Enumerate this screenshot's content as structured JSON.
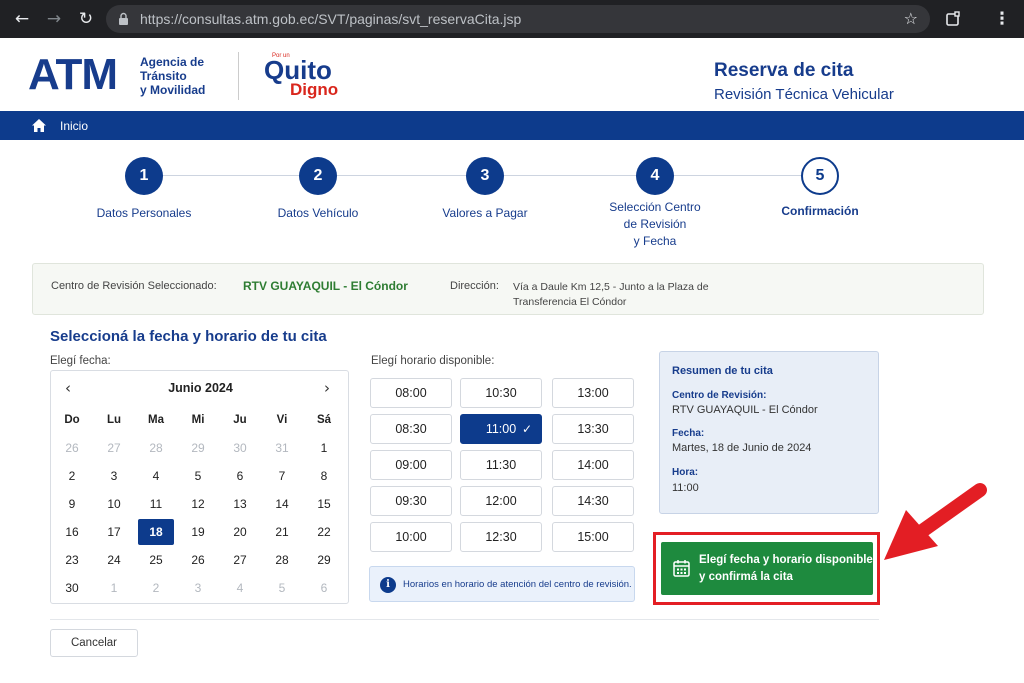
{
  "browser": {
    "url": "https://consultas.atm.gob.ec/SVT/paginas/svt_reservaCita.jsp"
  },
  "header": {
    "logo_text": "ATM",
    "logo_sub": [
      "Agencia de",
      "Tránsito",
      "y Movilidad"
    ],
    "quito_small": "Por un",
    "quito": "Quito",
    "digno": "Digno",
    "title": "Reserva de cita",
    "subtitle": "Revisión Técnica Vehicular"
  },
  "navbar": {
    "home_label": "Inicio"
  },
  "steps": [
    {
      "number": "1",
      "label": "Datos Personales",
      "state": "completed"
    },
    {
      "number": "2",
      "label": "Datos Vehículo",
      "state": "completed"
    },
    {
      "number": "3",
      "label": "Valores a Pagar",
      "state": "completed"
    },
    {
      "number": "4",
      "label_lines": [
        "Selección Centro",
        "de Revisión",
        "y Fecha"
      ],
      "state": "completed"
    },
    {
      "number": "5",
      "label": "Confirmación",
      "state": "current"
    }
  ],
  "center": {
    "label": "Centro de Revisión Seleccionado:",
    "value": "RTV GUAYAQUIL - El Cóndor",
    "dir_label": "Dirección:",
    "dir_value_lines": [
      "Vía a Daule Km 12,5 - Junto a la Plaza de",
      "Transferencia El Cóndor"
    ]
  },
  "main": {
    "section_title": "Seleccioná la fecha y horario de tu cita",
    "fecha_label": "Elegí fecha:",
    "horario_label": "Elegí horario disponible:"
  },
  "calendar": {
    "month_label": "Junio  2024",
    "weekdays": [
      "Do",
      "Lu",
      "Ma",
      "Mi",
      "Ju",
      "Vi",
      "Sá"
    ],
    "weeks": [
      [
        [
          "26",
          1
        ],
        [
          "27",
          1
        ],
        [
          "28",
          1
        ],
        [
          "29",
          1
        ],
        [
          "30",
          1
        ],
        [
          "31",
          1
        ],
        [
          "1",
          0
        ]
      ],
      [
        [
          "2",
          0
        ],
        [
          "3",
          0
        ],
        [
          "4",
          0
        ],
        [
          "5",
          0
        ],
        [
          "6",
          0
        ],
        [
          "7",
          0
        ],
        [
          "8",
          0
        ]
      ],
      [
        [
          "9",
          0
        ],
        [
          "10",
          0
        ],
        [
          "11",
          0
        ],
        [
          "12",
          0
        ],
        [
          "13",
          0
        ],
        [
          "14",
          0
        ],
        [
          "15",
          0
        ]
      ],
      [
        [
          "16",
          0
        ],
        [
          "17",
          0
        ],
        [
          "18",
          2
        ],
        [
          "19",
          0
        ],
        [
          "20",
          0
        ],
        [
          "21",
          0
        ],
        [
          "22",
          0
        ]
      ],
      [
        [
          "23",
          0
        ],
        [
          "24",
          0
        ],
        [
          "25",
          0
        ],
        [
          "26",
          0
        ],
        [
          "27",
          0
        ],
        [
          "28",
          0
        ],
        [
          "29",
          0
        ]
      ],
      [
        [
          "30",
          0
        ],
        [
          "1",
          1
        ],
        [
          "2",
          1
        ],
        [
          "3",
          1
        ],
        [
          "4",
          1
        ],
        [
          "5",
          1
        ],
        [
          "6",
          1
        ]
      ]
    ]
  },
  "slots": {
    "columns": [
      [
        "08:00",
        "08:30",
        "09:00",
        "09:30",
        "10:00"
      ],
      [
        "10:30",
        "11:00",
        "11:30",
        "12:00",
        "12:30"
      ],
      [
        "13:00",
        "13:30",
        "14:00",
        "14:30",
        "15:00"
      ]
    ],
    "selected": "11:00",
    "check_icon": "✓"
  },
  "info_note": {
    "icon": "i",
    "text": "Horarios en horario de atención del centro de revisión."
  },
  "summary": {
    "title": "Resumen de tu cita",
    "centro_label": "Centro de Revisión:",
    "centro_value": "RTV GUAYAQUIL - El Cóndor",
    "fecha_label": "Fecha:",
    "fecha_value": "Martes, 18 de Junio de 2024",
    "hora_label": "Hora:",
    "hora_value": "11:00"
  },
  "confirm_button": {
    "lines": [
      "Elegí fecha y horario disponible",
      "y confirmá la cita"
    ]
  },
  "cancel_button": {
    "label": "Cancelar"
  },
  "colors": {
    "primary": "#0d3b8c",
    "success": "#1e8a3e",
    "highlight": "#e31e24",
    "accent_red": "#d9261c"
  }
}
